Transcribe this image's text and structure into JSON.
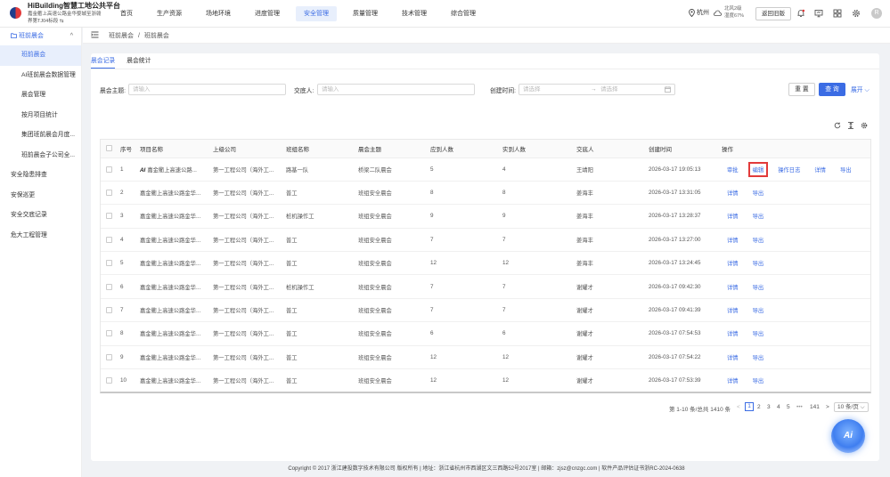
{
  "header": {
    "brand_title": "HiBuilding智慧工地公共平台",
    "project_line1": "嘉金衢上高速公路金华婺城至浙赣",
    "project_line2": "界第TJ04标段 ⇆",
    "nav": [
      "首页",
      "生产资源",
      "场地环境",
      "进度管理",
      "安全管理",
      "质量管理",
      "技术管理",
      "综合管理"
    ],
    "active_nav": "安全管理",
    "city": "杭州",
    "weather_wind": "北风2级",
    "weather_humidity": "湿度67%",
    "back_button": "返回旧版",
    "avatar_letter": "R"
  },
  "sidebar": {
    "group_label": "班前晨会",
    "group_chevron": "^",
    "sub_items": [
      "班前晨会",
      "AI班前晨会数据管理",
      "晨会管理",
      "按月项目统计",
      "集团班前晨会月度...",
      "班前晨会子公司全..."
    ],
    "active_item": "班前晨会",
    "top_items": [
      "安全隐患排查",
      "安保巡更",
      "安全交底记录",
      "危大工程管理"
    ]
  },
  "breadcrumb": [
    "班前晨会",
    "/",
    "班前晨会"
  ],
  "tabs": [
    "晨会记录",
    "晨会统计"
  ],
  "active_tab": "晨会记录",
  "filters": {
    "topic_label": "晨会主题:",
    "topic_placeholder": "请输入",
    "presenter_label": "交底人:",
    "presenter_placeholder": "请输入",
    "created_label": "创建时间:",
    "start_placeholder": "请选择",
    "end_placeholder": "请选择",
    "range_arrow": "→",
    "reset": "重 置",
    "query": "查 询",
    "expand": "展开 ⌵"
  },
  "table": {
    "headers": [
      "",
      "序号",
      "项目名称",
      "上级公司",
      "班组名称",
      "晨会主题",
      "应到人数",
      "实到人数",
      "交底人",
      "创建时间",
      "操作"
    ],
    "rows": [
      {
        "no": "1",
        "project": "嘉金衢上高速公路...",
        "ai": true,
        "company": "第一工程公司（海外工...",
        "team": "路基一队",
        "topic": "桥梁二队晨会",
        "expected": "5",
        "actual": "4",
        "presenter": "王靖阳",
        "created": "2026-03-17 19:05:13",
        "ops": [
          "审批",
          "编辑",
          "操作日志",
          "详情",
          "导出"
        ]
      },
      {
        "no": "2",
        "project": "嘉金衢上高速公路金华...",
        "ai": false,
        "company": "第一工程公司（海外工...",
        "team": "普工",
        "topic": "班组安全晨会",
        "expected": "8",
        "actual": "8",
        "presenter": "姜海丰",
        "created": "2026-03-17 13:31:05",
        "ops": [
          "详情",
          "导出"
        ]
      },
      {
        "no": "3",
        "project": "嘉金衢上高速公路金华...",
        "ai": false,
        "company": "第一工程公司（海外工...",
        "team": "桩机操作工",
        "topic": "班组安全晨会",
        "expected": "9",
        "actual": "9",
        "presenter": "姜海丰",
        "created": "2026-03-17 13:28:37",
        "ops": [
          "详情",
          "导出"
        ]
      },
      {
        "no": "4",
        "project": "嘉金衢上高速公路金华...",
        "ai": false,
        "company": "第一工程公司（海外工...",
        "team": "普工",
        "topic": "班组安全晨会",
        "expected": "7",
        "actual": "7",
        "presenter": "姜海丰",
        "created": "2026-03-17 13:27:00",
        "ops": [
          "详情",
          "导出"
        ]
      },
      {
        "no": "5",
        "project": "嘉金衢上高速公路金华...",
        "ai": false,
        "company": "第一工程公司（海外工...",
        "team": "普工",
        "topic": "班组安全晨会",
        "expected": "12",
        "actual": "12",
        "presenter": "姜海丰",
        "created": "2026-03-17 13:24:45",
        "ops": [
          "详情",
          "导出"
        ]
      },
      {
        "no": "6",
        "project": "嘉金衢上高速公路金华...",
        "ai": false,
        "company": "第一工程公司（海外工...",
        "team": "桩机操作工",
        "topic": "班组安全晨会",
        "expected": "7",
        "actual": "7",
        "presenter": "谢耀才",
        "created": "2026-03-17 09:42:30",
        "ops": [
          "详情",
          "导出"
        ]
      },
      {
        "no": "7",
        "project": "嘉金衢上高速公路金华...",
        "ai": false,
        "company": "第一工程公司（海外工...",
        "team": "普工",
        "topic": "班组安全晨会",
        "expected": "7",
        "actual": "7",
        "presenter": "谢耀才",
        "created": "2026-03-17 09:41:39",
        "ops": [
          "详情",
          "导出"
        ]
      },
      {
        "no": "8",
        "project": "嘉金衢上高速公路金华...",
        "ai": false,
        "company": "第一工程公司（海外工...",
        "team": "普工",
        "topic": "班组安全晨会",
        "expected": "6",
        "actual": "6",
        "presenter": "谢耀才",
        "created": "2026-03-17 07:54:53",
        "ops": [
          "详情",
          "导出"
        ]
      },
      {
        "no": "9",
        "project": "嘉金衢上高速公路金华...",
        "ai": false,
        "company": "第一工程公司（海外工...",
        "team": "普工",
        "topic": "班组安全晨会",
        "expected": "12",
        "actual": "12",
        "presenter": "谢耀才",
        "created": "2026-03-17 07:54:22",
        "ops": [
          "详情",
          "导出"
        ]
      },
      {
        "no": "10",
        "project": "嘉金衢上高速公路金华...",
        "ai": false,
        "company": "第一工程公司（海外工...",
        "team": "普工",
        "topic": "班组安全晨会",
        "expected": "12",
        "actual": "12",
        "presenter": "谢耀才",
        "created": "2026-03-17 07:53:39",
        "ops": [
          "详情",
          "导出"
        ]
      }
    ],
    "highlighted_op": "编辑"
  },
  "pagination": {
    "summary": "第 1-10 条/总共 1410 条",
    "prev": "<",
    "pages": [
      "1",
      "2",
      "3",
      "4",
      "5",
      "•••",
      "141"
    ],
    "current": "1",
    "next": ">",
    "page_size": "10 条/页 ⌵"
  },
  "ai_fab_label": "Ai",
  "footer": "Copyright © 2017 浙江建投数字技术有限公司 版权所有 | 地址：浙江省杭州市西湖区文三西路52号2017室 | 邮箱：zjsz@cnzgc.com | 软件产品评估证书浙RC-2024-0638",
  "colors": {
    "primary": "#3b6ce4",
    "highlight_border": "#e23a3a",
    "page_bg": "#f0f2f5"
  }
}
